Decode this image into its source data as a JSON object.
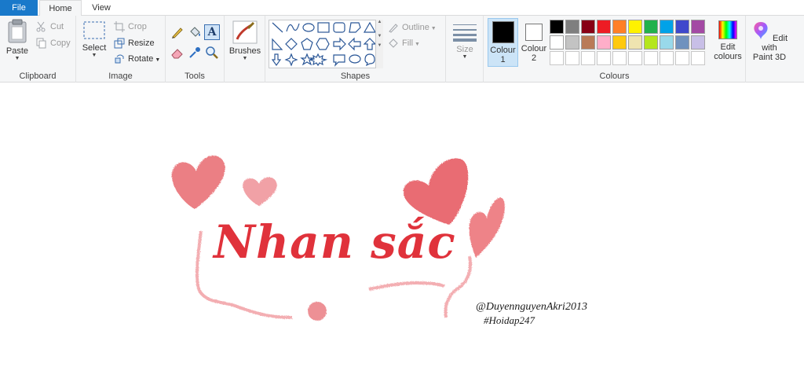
{
  "tabs": {
    "file": "File",
    "home": "Home",
    "view": "View"
  },
  "clipboard": {
    "paste": "Paste",
    "cut": "Cut",
    "copy": "Copy",
    "label": "Clipboard"
  },
  "image": {
    "select": "Select",
    "crop": "Crop",
    "resize": "Resize",
    "rotate": "Rotate",
    "label": "Image"
  },
  "tools": {
    "label": "Tools"
  },
  "brushes": {
    "label": "Brushes"
  },
  "shapes": {
    "outline": "Outline",
    "fill": "Fill",
    "label": "Shapes"
  },
  "size": {
    "label": "Size"
  },
  "colours": {
    "colour1": "Colour",
    "colour1_num": "1",
    "colour2": "Colour",
    "colour2_num": "2",
    "edit_line1": "Edit",
    "edit_line2": "colours",
    "label": "Colours",
    "colour1_value": "#000000",
    "colour2_value": "#ffffff",
    "palette_row1": [
      "#000000",
      "#7f7f7f",
      "#880015",
      "#ed1c24",
      "#ff7f27",
      "#fff200",
      "#22b14c",
      "#00a2e8",
      "#3f48cc",
      "#a349a4"
    ],
    "palette_row2": [
      "#ffffff",
      "#c3c3c3",
      "#b97a57",
      "#ffaec9",
      "#ffc90e",
      "#efe4b0",
      "#b5e61d",
      "#99d9ea",
      "#7092be",
      "#c8bfe7"
    ]
  },
  "paint3d": {
    "line1": "Edit with",
    "line2": "Paint 3D"
  },
  "canvas": {
    "title": "Nhan sắc",
    "watermark_author": "@DuyennguyenAkri2013",
    "watermark_tag": "#Hoidap247",
    "ink_color": "#e0323b",
    "crayon_color": "#e8535b"
  }
}
